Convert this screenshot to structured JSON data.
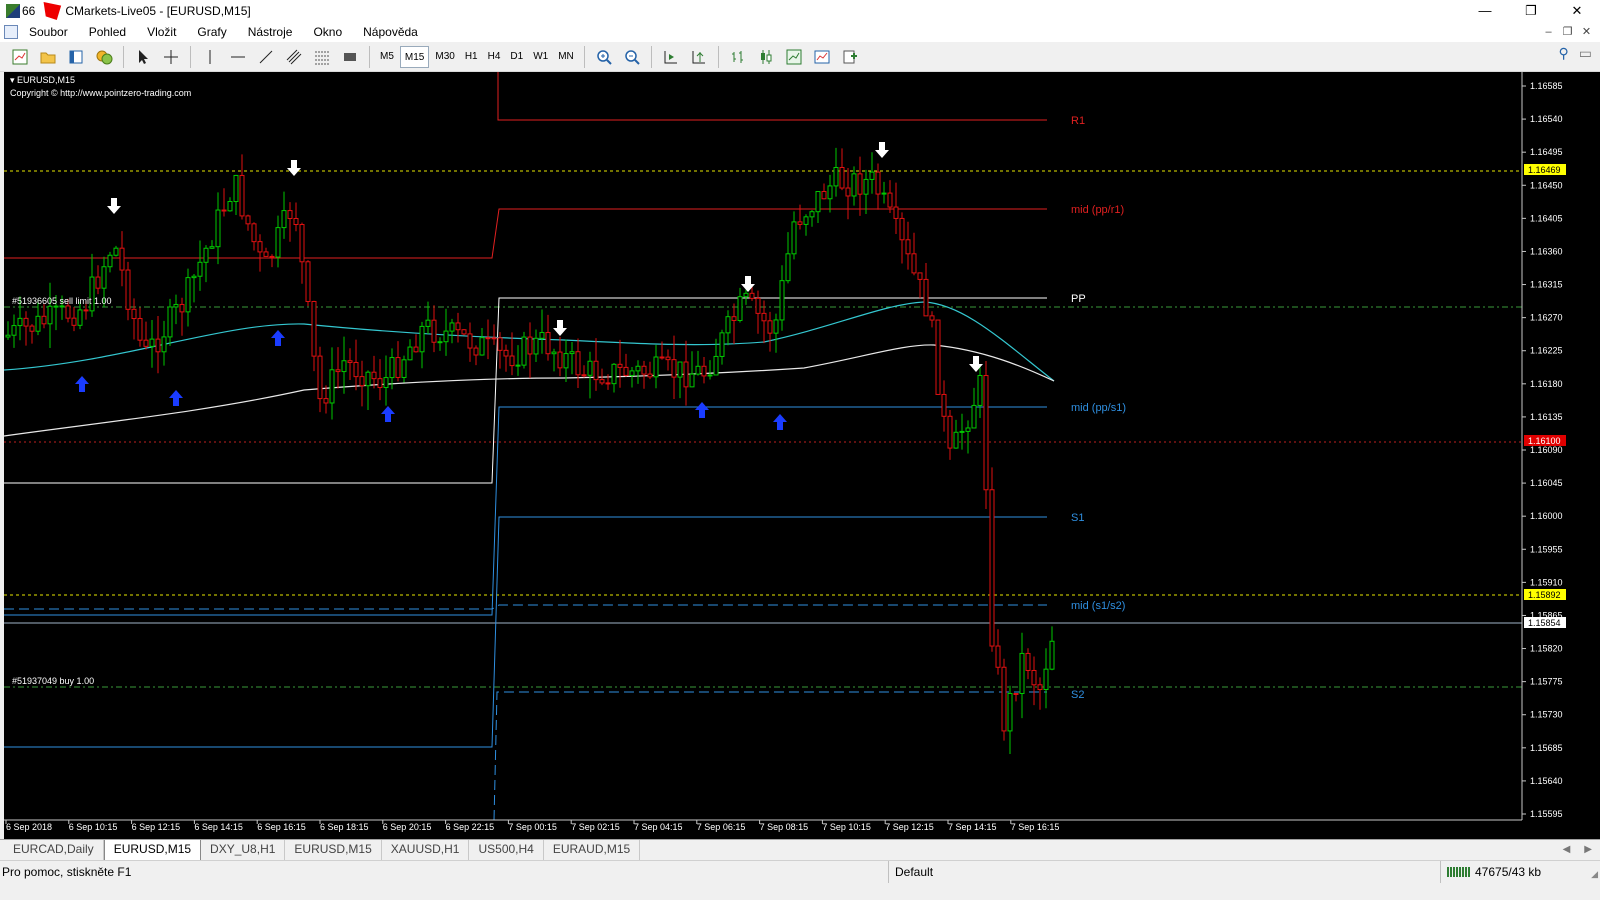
{
  "window": {
    "title": "CMarkets-Live05 - [EURUSD,M15]",
    "title_prefix": "66",
    "controls": [
      "—",
      "❐",
      "✕"
    ]
  },
  "menu": {
    "items": [
      "Soubor",
      "Pohled",
      "Vložit",
      "Grafy",
      "Nástroje",
      "Okno",
      "Nápověda"
    ],
    "mdi_controls": [
      "–",
      "❐",
      "✕"
    ]
  },
  "toolbar": {
    "timeframes": [
      "M5",
      "M15",
      "M30",
      "H1",
      "H4",
      "D1",
      "W1",
      "MN"
    ],
    "active_timeframe": "M15"
  },
  "chart": {
    "symbol_label": "EURUSD,M15",
    "copyright": "Copyright © http://www.pointzero-trading.com",
    "order_sell_label": "#51936605 sell limit 1.00",
    "order_buy_label": "#51937049 buy 1.00",
    "bid_price": "1.15892",
    "ask_price": "1.15854",
    "yellow_line_price": "1.16469",
    "red_line_price": "1.16100",
    "colors": {
      "background": "#000000",
      "bull": "#00c800",
      "bear": "#e01010",
      "ma_fast": "#34c7d0",
      "ma_slow": "#e8e8e8",
      "resistance": "#e02020",
      "support": "#2f8fe0",
      "pivot": "#ffffff"
    },
    "price_ticks": [
      "1.16585",
      "1.16540",
      "1.16495",
      "1.16450",
      "1.16405",
      "1.16360",
      "1.16315",
      "1.16270",
      "1.16225",
      "1.16180",
      "1.16135",
      "1.16090",
      "1.16045",
      "1.16000",
      "1.15955",
      "1.15910",
      "1.15865",
      "1.15820",
      "1.15775",
      "1.15730",
      "1.15685",
      "1.15640",
      "1.15595"
    ],
    "time_ticks": [
      "6 Sep 2018",
      "6 Sep 10:15",
      "6 Sep 12:15",
      "6 Sep 14:15",
      "6 Sep 16:15",
      "6 Sep 18:15",
      "6 Sep 20:15",
      "6 Sep 22:15",
      "7 Sep 00:15",
      "7 Sep 02:15",
      "7 Sep 04:15",
      "7 Sep 06:15",
      "7 Sep 08:15",
      "7 Sep 10:15",
      "7 Sep 12:15",
      "7 Sep 14:15",
      "7 Sep 16:15"
    ],
    "pivot_labels": [
      {
        "text": "R1",
        "color": "#e02020"
      },
      {
        "text": "mid (pp/r1)",
        "color": "#e02020"
      },
      {
        "text": "PP",
        "color": "#ffffff"
      },
      {
        "text": "mid (pp/s1)",
        "color": "#2f8fe0"
      },
      {
        "text": "S1",
        "color": "#2f8fe0"
      },
      {
        "text": "mid (s1/s2)",
        "color": "#2f8fe0"
      },
      {
        "text": "S2",
        "color": "#2f8fe0"
      }
    ]
  },
  "tabs": {
    "items": [
      "EURCAD,Daily",
      "EURUSD,M15",
      "DXY_U8,H1",
      "EURUSD,M15",
      "XAUUSD,H1",
      "US500,H4",
      "EURAUD,M15"
    ],
    "active_index": 1
  },
  "status": {
    "help_text": "Pro pomoc, stiskněte F1",
    "profile": "Default",
    "traffic": "47675/43 kb"
  }
}
